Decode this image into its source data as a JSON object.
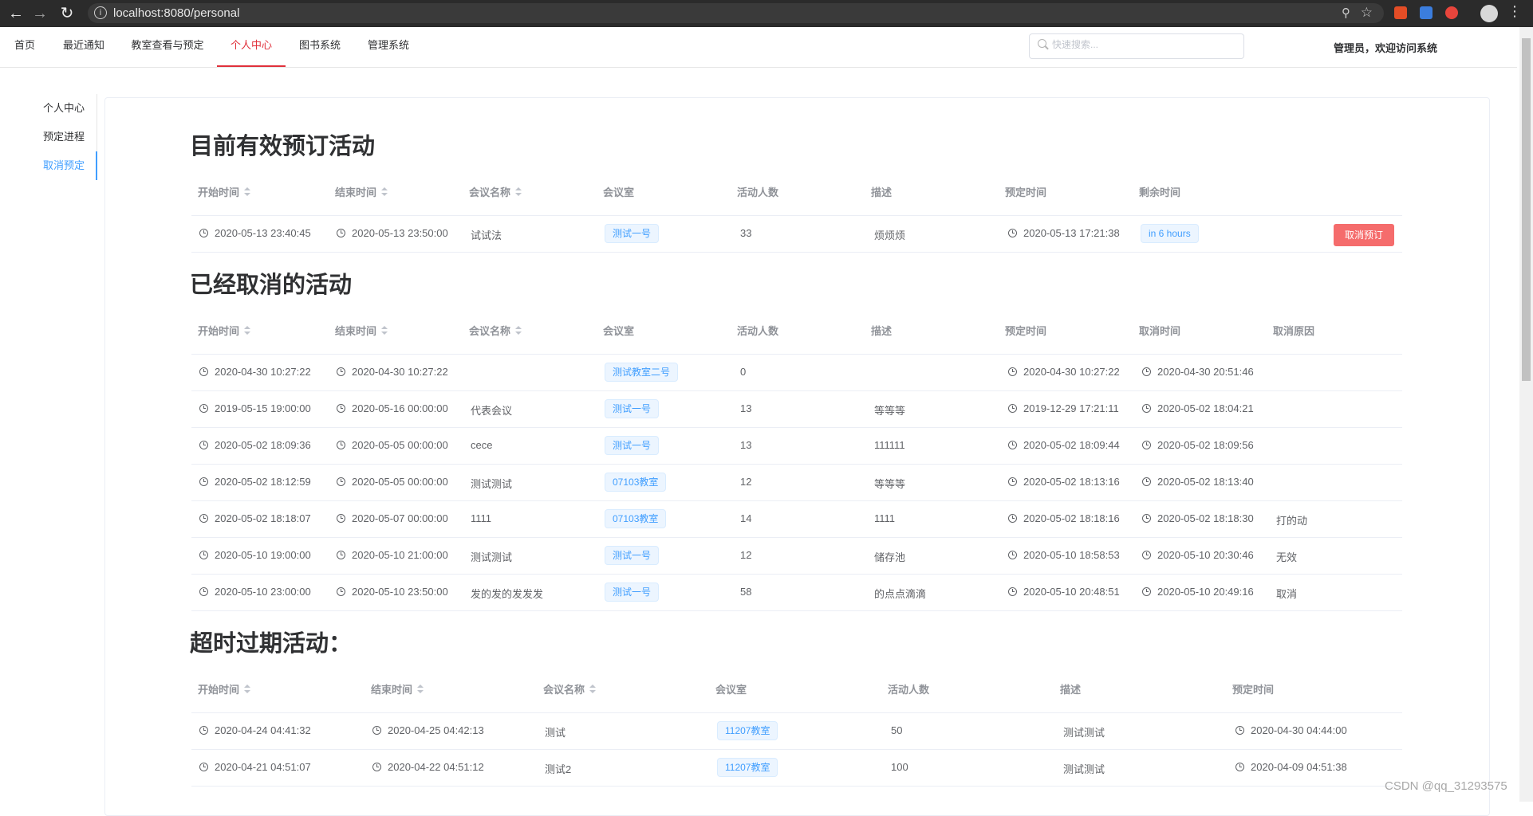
{
  "browser": {
    "url": "localhost:8080/personal"
  },
  "nav": {
    "items": [
      "首页",
      "最近通知",
      "教室查看与预定",
      "个人中心",
      "图书系统",
      "管理系统"
    ],
    "active_index": 3,
    "search_placeholder": "快速搜索...",
    "welcome": "管理员，欢迎访问系统"
  },
  "sidebar": {
    "items": [
      "个人中心",
      "预定进程",
      "取消预定"
    ],
    "active_index": 2
  },
  "active": {
    "title": "目前有效预订活动",
    "headers": [
      "开始时间",
      "结束时间",
      "会议名称",
      "会议室",
      "活动人数",
      "描述",
      "预定时间",
      "剩余时间"
    ],
    "rows": [
      {
        "start": "2020-05-13 23:40:45",
        "end": "2020-05-13 23:50:00",
        "name": "试试法",
        "room": "测试一号",
        "people": "33",
        "desc": "烦烦烦",
        "booked": "2020-05-13 17:21:38",
        "remaining": "in 6 hours",
        "action": "取消预订"
      }
    ]
  },
  "cancelled": {
    "title": "已经取消的活动",
    "headers": [
      "开始时间",
      "结束时间",
      "会议名称",
      "会议室",
      "活动人数",
      "描述",
      "预定时间",
      "取消时间",
      "取消原因"
    ],
    "rows": [
      {
        "start": "2020-04-30 10:27:22",
        "end": "2020-04-30 10:27:22",
        "name": "",
        "room": "测试教室二号",
        "people": "0",
        "desc": "",
        "booked": "2020-04-30 10:27:22",
        "cancel_time": "2020-04-30 20:51:46",
        "reason": ""
      },
      {
        "start": "2019-05-15 19:00:00",
        "end": "2020-05-16 00:00:00",
        "name": "代表会议",
        "room": "测试一号",
        "people": "13",
        "desc": "等等等",
        "booked": "2019-12-29 17:21:11",
        "cancel_time": "2020-05-02 18:04:21",
        "reason": ""
      },
      {
        "start": "2020-05-02 18:09:36",
        "end": "2020-05-05 00:00:00",
        "name": "cece",
        "room": "测试一号",
        "people": "13",
        "desc": "111111",
        "booked": "2020-05-02 18:09:44",
        "cancel_time": "2020-05-02 18:09:56",
        "reason": ""
      },
      {
        "start": "2020-05-02 18:12:59",
        "end": "2020-05-05 00:00:00",
        "name": "测试测试",
        "room": "07103教室",
        "people": "12",
        "desc": "等等等",
        "booked": "2020-05-02 18:13:16",
        "cancel_time": "2020-05-02 18:13:40",
        "reason": ""
      },
      {
        "start": "2020-05-02 18:18:07",
        "end": "2020-05-07 00:00:00",
        "name": "1111",
        "room": "07103教室",
        "people": "14",
        "desc": "1111",
        "booked": "2020-05-02 18:18:16",
        "cancel_time": "2020-05-02 18:18:30",
        "reason": "打的动"
      },
      {
        "start": "2020-05-10 19:00:00",
        "end": "2020-05-10 21:00:00",
        "name": "测试测试",
        "room": "测试一号",
        "people": "12",
        "desc": "储存池",
        "booked": "2020-05-10 18:58:53",
        "cancel_time": "2020-05-10 20:30:46",
        "reason": "无效"
      },
      {
        "start": "2020-05-10 23:00:00",
        "end": "2020-05-10 23:50:00",
        "name": "发的发的发发发",
        "room": "测试一号",
        "people": "58",
        "desc": "的点点滴滴",
        "booked": "2020-05-10 20:48:51",
        "cancel_time": "2020-05-10 20:49:16",
        "reason": "取消"
      }
    ]
  },
  "expired": {
    "title": "超时过期活动：",
    "headers": [
      "开始时间",
      "结束时间",
      "会议名称",
      "会议室",
      "活动人数",
      "描述",
      "预定时间"
    ],
    "rows": [
      {
        "start": "2020-04-24 04:41:32",
        "end": "2020-04-25 04:42:13",
        "name": "测试",
        "room": "11207教室",
        "people": "50",
        "desc": "测试测试",
        "booked": "2020-04-30 04:44:00"
      },
      {
        "start": "2020-04-21 04:51:07",
        "end": "2020-04-22 04:51:12",
        "name": "测试2",
        "room": "11207教室",
        "people": "100",
        "desc": "测试测试",
        "booked": "2020-04-09 04:51:38"
      }
    ]
  },
  "watermark": "CSDN @qq_31293575"
}
